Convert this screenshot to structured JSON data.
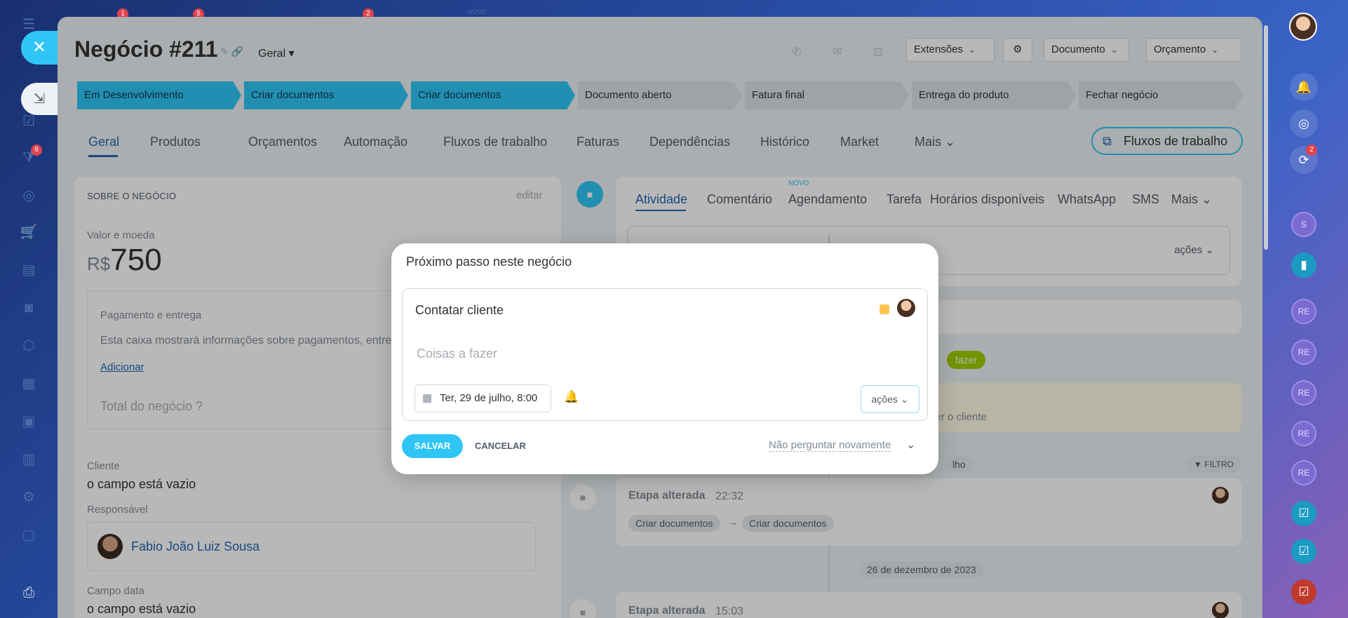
{
  "deal": {
    "title": "Negócio #211",
    "pipeline": "Geral",
    "header_buttons": {
      "extensions": "Extensões",
      "document": "Documento",
      "quote": "Orçamento"
    }
  },
  "stages": [
    {
      "label": "Em Desenvolvimento",
      "active": true
    },
    {
      "label": "Criar documentos",
      "active": true
    },
    {
      "label": "Criar documentos",
      "active": true
    },
    {
      "label": "Documento aberto",
      "active": false
    },
    {
      "label": "Fatura final",
      "active": false
    },
    {
      "label": "Entrega do produto",
      "active": false
    },
    {
      "label": "Fechar negócio",
      "active": false
    }
  ],
  "tabs": [
    "Geral",
    "Produtos",
    "Orçamentos",
    "Automação",
    "Fluxos de trabalho",
    "Faturas",
    "Dependências",
    "Histórico",
    "Market",
    "Mais"
  ],
  "workflows_button": "Fluxos de trabalho",
  "about": {
    "section_title": "SOBRE O NEGÓCIO",
    "edit": "editar",
    "amount_label": "Valor e moeda",
    "currency": "R$",
    "amount": "750",
    "payment_title": "Pagamento e entrega",
    "payment_text": "Esta caixa mostrará informações sobre pagamentos, entre",
    "add": "Adicionar",
    "total_label": "Total do negócio",
    "client_label": "Cliente",
    "client_value": "o campo está vazio",
    "responsible_label": "Responsável",
    "responsible_name": "Fabio João Luiz Sousa",
    "date_label": "Campo data",
    "date_value": "o campo está vazio"
  },
  "activity": {
    "tabs": [
      "Atividade",
      "Comentário",
      "Agendamento",
      "Tarefa",
      "Horários disponíveis",
      "WhatsApp",
      "SMS",
      "Mais"
    ],
    "new_badge": "NOVO",
    "actions": "ações",
    "todo_chip": "fazer",
    "client_text": "cer o cliente",
    "work_chip": "lho",
    "filter": "FILTRO",
    "entry1_title": "Etapa alterada",
    "entry1_time": "22:32",
    "entry1_from": "Criar documentos",
    "entry1_to": "Criar documentos",
    "date_sep": "26 de dezembro de 2023",
    "entry2_title": "Etapa alterada",
    "entry2_time": "15:03"
  },
  "modal": {
    "title": "Próximo passo neste negócio",
    "task": "Contatar cliente",
    "todo_placeholder": "Coisas a fazer",
    "date": "Ter, 29 de julho, 8:00",
    "actions": "ações",
    "save": "SALVAR",
    "cancel": "CANCELAR",
    "dont_ask": "Não perguntar novamente"
  },
  "badges": {
    "left_top1": "1",
    "left_top2": "5",
    "left_top3": "2",
    "left_new": "NOVO",
    "crm": "8",
    "right_chat": "2"
  },
  "right_avatars": [
    "S",
    "RE",
    "RE",
    "RE",
    "RE",
    "RE"
  ],
  "colors": {
    "accent": "#2fc6f6",
    "link": "#2066b0",
    "badge": "#e0434b"
  }
}
